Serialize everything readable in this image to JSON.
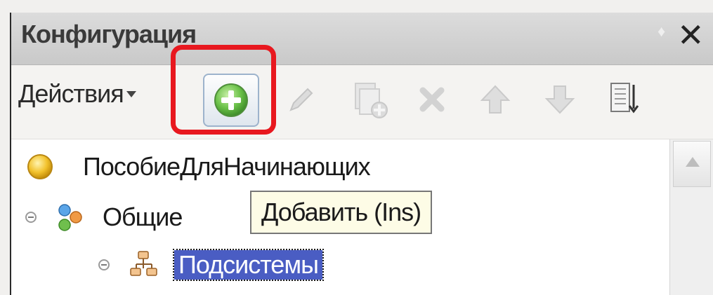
{
  "window": {
    "title": "Конфигурация"
  },
  "toolbar": {
    "actions_label": "Действия"
  },
  "tooltip": {
    "text": "Добавить (Ins)"
  },
  "tree": {
    "root": {
      "label": "ПособиеДляНачинающих"
    },
    "common": {
      "label": "Общие"
    },
    "subsystems": {
      "label": "Подсистемы"
    }
  },
  "colors": {
    "selection": "#4a5dc3",
    "highlight": "#e8181f",
    "tooltip_bg": "#fdfce6"
  },
  "icons": [
    "pin-icon",
    "close-icon",
    "add-icon",
    "edit-icon",
    "copy-icon",
    "delete-icon",
    "move-up-icon",
    "move-down-icon",
    "list-icon",
    "configuration-icon",
    "common-icon",
    "subsystems-icon"
  ]
}
